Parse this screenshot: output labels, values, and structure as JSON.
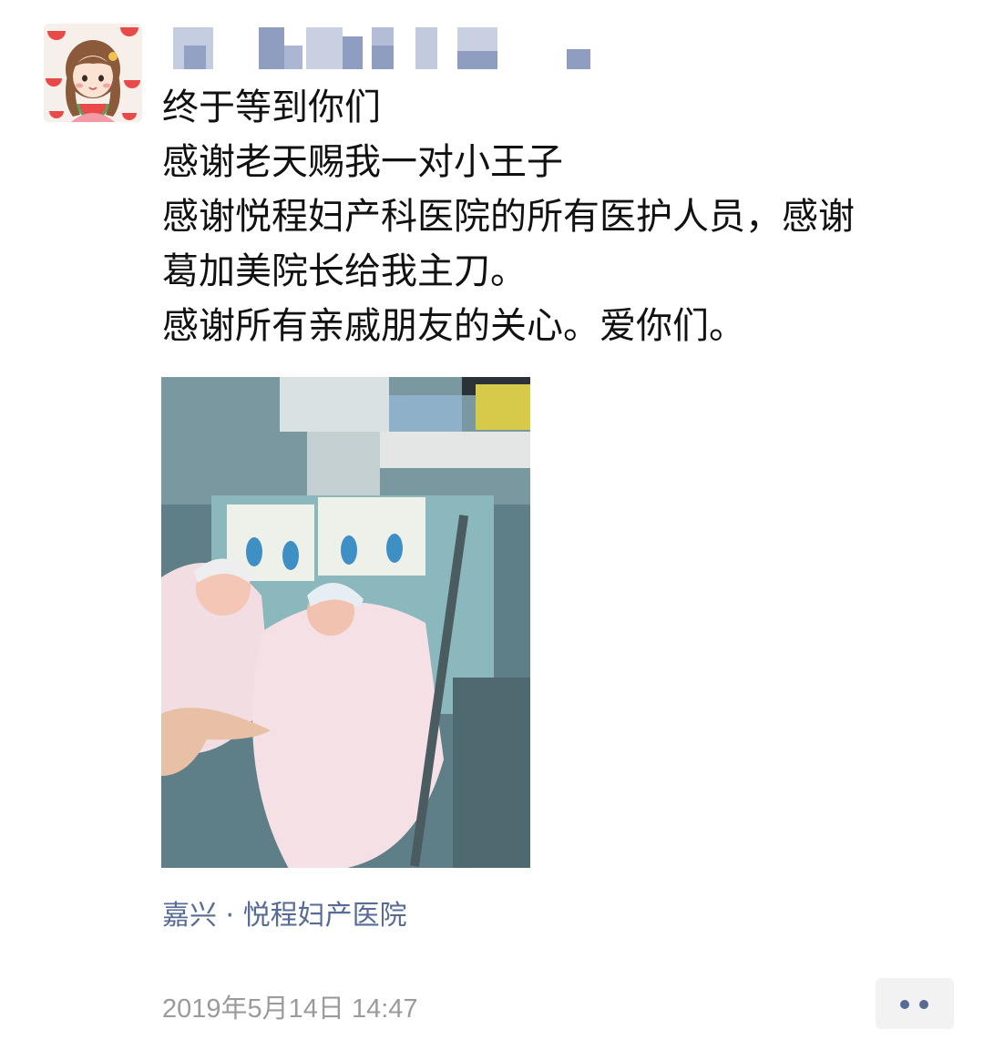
{
  "post": {
    "lines": [
      "终于等到你们",
      "感谢老天赐我一对小王子",
      "感谢悦程妇产科医院的所有医护人员，感谢",
      "葛加美院长给我主刀。",
      "感谢所有亲戚朋友的关心。爱你们。"
    ],
    "location": "嘉兴 · 悦程妇产医院",
    "timestamp": "2019年5月14日 14:47",
    "avatar_icon": "cartoon-girl-avatar",
    "more_icon": "more-dots-icon"
  },
  "colors": {
    "link": "#576b95",
    "text": "#111111",
    "meta": "#9b9b9b",
    "button_bg": "#f2f2f2",
    "redacted_name": "#b9c3da"
  }
}
